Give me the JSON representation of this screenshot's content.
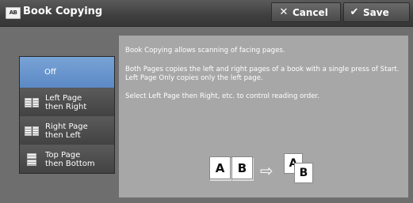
{
  "header": {
    "title_icon_text": "AB",
    "title": "Book Copying",
    "cancel_label": "Cancel",
    "save_label": "Save",
    "cancel_icon": "x-icon",
    "save_icon": "checkmark-icon"
  },
  "options": [
    {
      "label": "Off",
      "selected": true
    },
    {
      "label_line1": "Left Page",
      "label_line2": "then Right",
      "icon": "book-left-right-icon"
    },
    {
      "label_line1": "Right Page",
      "label_line2": "then Left",
      "icon": "book-right-left-icon"
    },
    {
      "label_line1": "Top Page",
      "label_line2": "then Bottom",
      "icon": "book-top-bottom-icon"
    }
  ],
  "description": {
    "line1": "Book Copying allows scanning of facing pages.",
    "line2": "Both Pages copies the left and right pages of a book with a single press of Start.  Left Page Only copies only the left page.",
    "line3": "Select Left Page then Right, etc. to control reading order."
  },
  "illustration": {
    "page_left": "A",
    "page_right": "B",
    "arrow": "⇨",
    "out_first": "A",
    "out_second": "B"
  },
  "colors": {
    "selected": "#6b97cd",
    "header": "#3f3f3f",
    "panel": "#a7a7a7"
  }
}
